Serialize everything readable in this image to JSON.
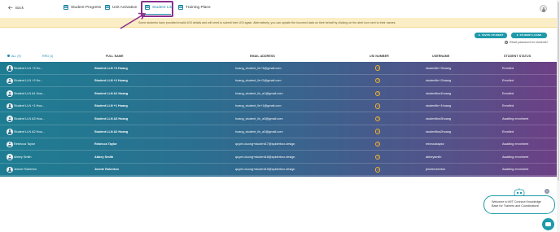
{
  "nav": {
    "back_label": "Back",
    "tabs": [
      {
        "label": "Student Progress",
        "icon": "chart-icon"
      },
      {
        "label": "Unit Activation",
        "icon": "list-icon"
      },
      {
        "label": "Student List",
        "icon": "list-icon",
        "active": true
      },
      {
        "label": "Training Plans",
        "icon": "calendar-icon"
      }
    ],
    "accent_color": "#1e88a8",
    "highlight_color": "#8a2e8e"
  },
  "banner": {
    "text": "Some students have provided invalid USI details and will need to submit their USI again. Alternatively, you can update the incorrect data on their behalf by clicking on the alert icon next to their names."
  },
  "actions": {
    "invite_label": "INVITE STUDENT",
    "loans_label": "STUDENT LOANS",
    "reset_label": "Reset password for students?"
  },
  "filters": {
    "all_label": "ALL (9)",
    "ready_label": "RRG (1)"
  },
  "table": {
    "headers": {
      "full_name": "FULL NAME",
      "email": "EMAIL ADDRESS",
      "usi": "USI NUMBER",
      "username": "USERNAME",
      "status": "STUDENT STATUS"
    },
    "rows": [
      {
        "short": "Student LLN +3 Ho...",
        "full": "Student LLN +3 Hoang",
        "email": "hoang_student_lln+3@gmail.com",
        "username": "studentlln+3hoang",
        "status": "Enrolled"
      },
      {
        "short": "Student LLN +2 Ho...",
        "full": "Student LLN +2 Hoang",
        "email": "hoang_student_lln+2@gmail.com",
        "username": "studentlln+2hoang",
        "status": "Enrolled"
      },
      {
        "short": "Student LLN A1 Hoa...",
        "full": "Student LLN A1 Hoang",
        "email": "hoang_student_lln_a1@gmail.com",
        "username": "studentllna1hoang",
        "status": "Enrolled"
      },
      {
        "short": "Student LLN +1 Hoa...",
        "full": "Student LLN +1 Hoang",
        "email": "hoang_student_lln+1@gmail.com",
        "username": "studentlln+1hoang",
        "status": "Enrolled"
      },
      {
        "short": "Student LLN A3 Hoa...",
        "full": "Student LLN A3 Hoang",
        "email": "hoang_student_lln_a3@gmail.com",
        "username": "studentllna3hoang",
        "status": "Awaiting enrolment"
      },
      {
        "short": "Student LLN A2 Hoa...",
        "full": "Student LLN A2 Hoang",
        "email": "hoang_student_lln_a2@gmail.com",
        "username": "studentllna2hoang",
        "status": "Enrolled"
      },
      {
        "short": "Rebecca Taylor",
        "full": "Rebecca Taylor",
        "email": "quynh.duong+student17@spiderbox.design",
        "username": "rebeccataylor",
        "status": "Awaiting enrolment"
      },
      {
        "short": "Abbey Smith",
        "full": "Abbey Smith",
        "email": "quynh.duong+student18@spiderbox.design",
        "username": "abbeysmith",
        "status": "Awaiting enrolment"
      },
      {
        "short": "Jennie Roberton",
        "full": "Jennie Roberton",
        "email": "quynh.duong+student19@spiderbox.design",
        "username": "jennieroberton",
        "status": "Awaiting enrolment"
      }
    ]
  },
  "chat": {
    "bubble_text": "Welcome to MIT Connect Knowledge Base for Trainers and Coordinators!",
    "close_label": "×"
  }
}
